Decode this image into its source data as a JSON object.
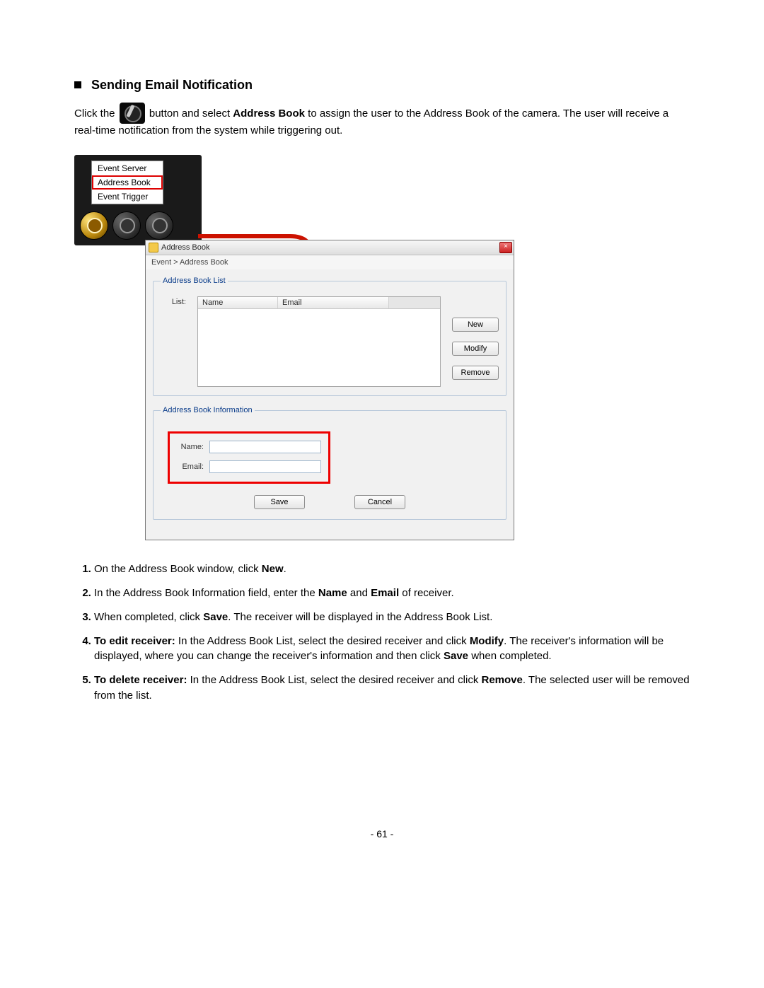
{
  "doc": {
    "heading": "Sending Email Notification",
    "intro_1_a": "Click the ",
    "intro_1_b": " button and select ",
    "intro_1_bold": "Address Book",
    "intro_1_c": " to assign the user to the Address Book of the camera. The user will receive a real-time notification from the system while triggering out.",
    "menu": {
      "item1": "Event Server",
      "item2": "Address Book",
      "item3": "Event Trigger"
    },
    "dialog": {
      "title": "Address Book",
      "breadcrumb": "Event > Address Book",
      "group_list_legend": "Address Book List",
      "list_label": "List:",
      "col_name": "Name",
      "col_email": "Email",
      "buttons": {
        "new": "New",
        "modify": "Modify",
        "remove": "Remove",
        "save": "Save",
        "cancel": "Cancel"
      },
      "group_info_legend": "Address Book Information",
      "field_name_label": "Name:",
      "field_email_label": "Email:",
      "close_glyph": "×"
    },
    "steps": {
      "s1_a": "On the Address Book window, click ",
      "s1_b": "New",
      "s1_c": ".",
      "s2_a": "In the Address Book Information field, enter the ",
      "s2_b": "Name",
      "s2_c": " and ",
      "s2_d": "Email",
      "s2_e": " of receiver.",
      "s3_a": "When completed, click ",
      "s3_b": "Save",
      "s3_c": ". The receiver will be displayed in the Address Book List.",
      "s4_a": "To edit receiver:",
      "s4_b": " In the Address Book List, select the desired receiver and click ",
      "s4_c": "Modify",
      "s4_d": ". The receiver's information will be displayed, where you can change the receiver's information and then click ",
      "s4_e": "Save",
      "s4_f": " when completed.",
      "s5_a": "To delete receiver:",
      "s5_b": " In the Address Book List, select the desired receiver and click ",
      "s5_c": "Remove",
      "s5_d": ". The selected user will be removed from the list."
    },
    "page_number": "- 61 -"
  }
}
